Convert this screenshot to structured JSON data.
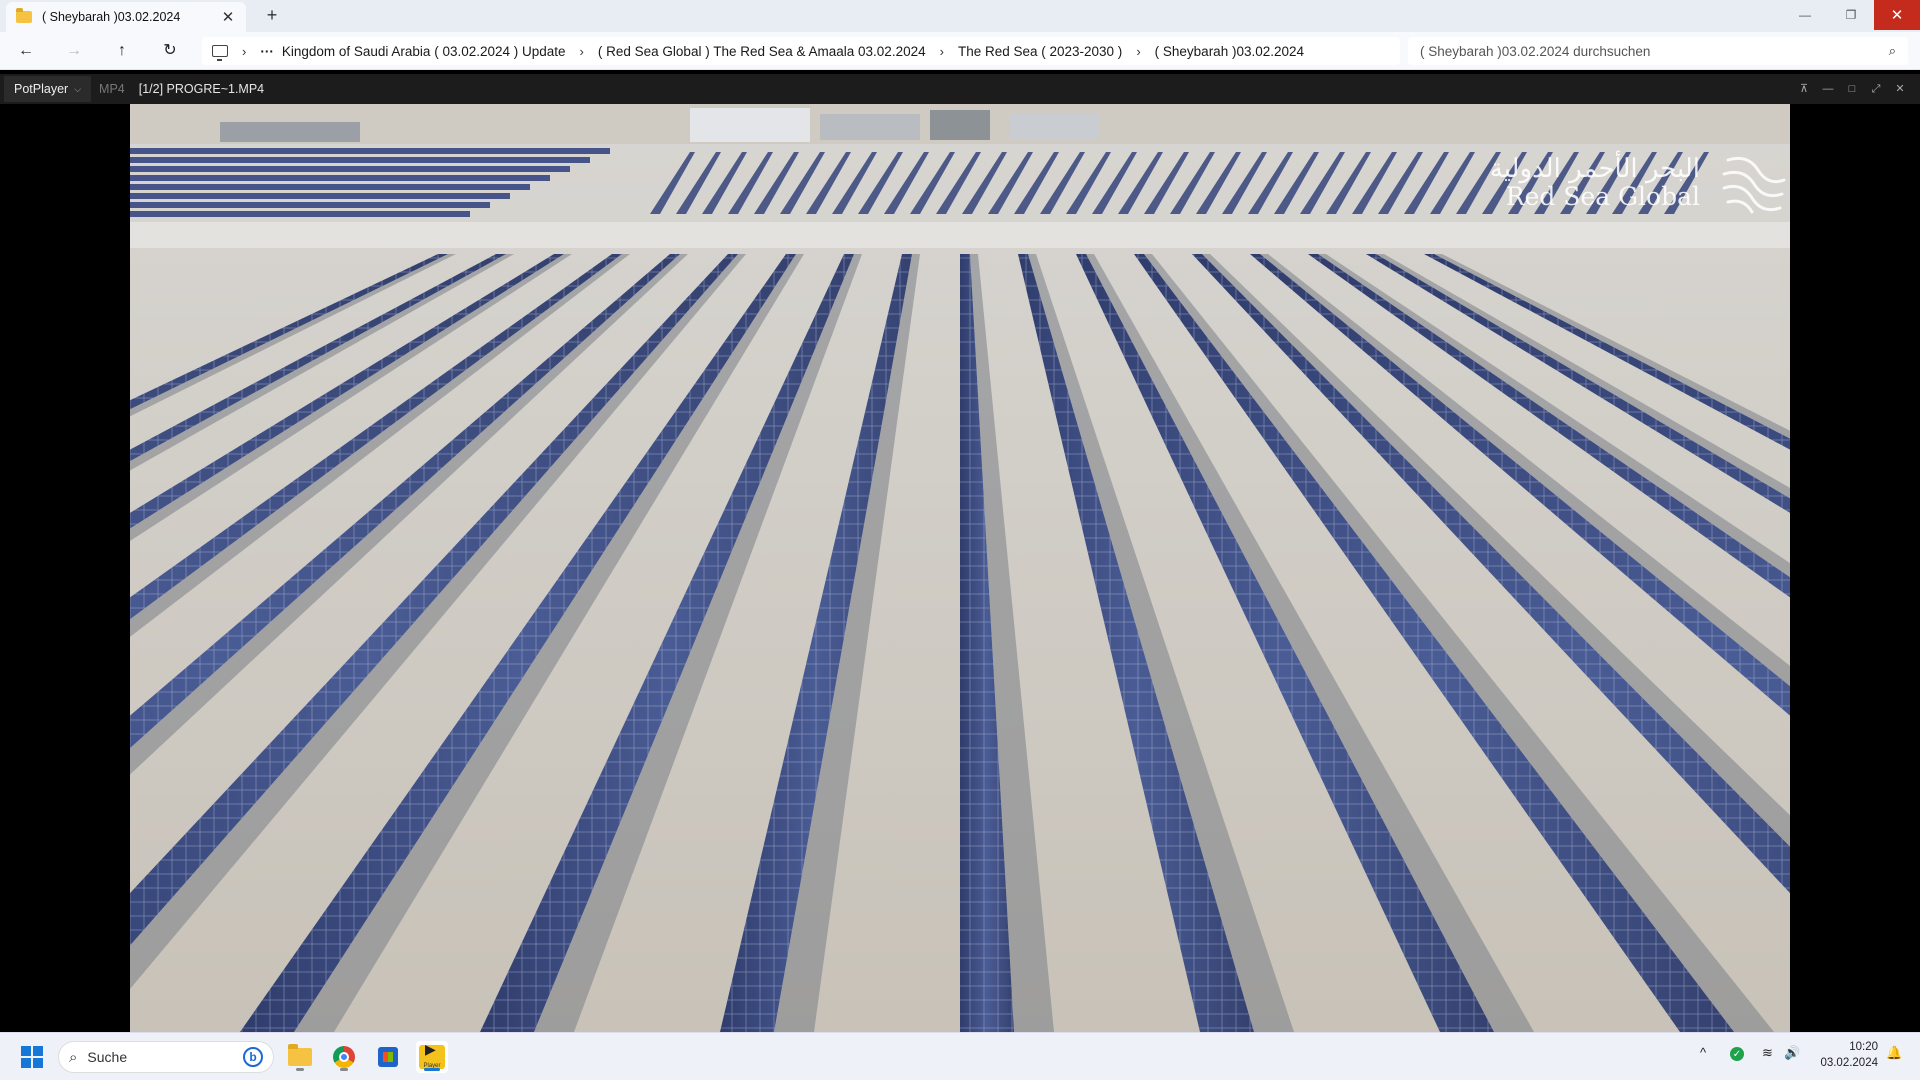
{
  "explorer": {
    "tab_title": "( Sheybarah )03.02.2024",
    "tab_close": "✕",
    "new_tab": "+",
    "window_controls": {
      "minimize": "—",
      "restore": "❐",
      "close": "✕"
    },
    "nav": {
      "back": "←",
      "forward": "→",
      "up": "↑",
      "refresh": "↻"
    },
    "breadcrumb_overflow": "···",
    "breadcrumbs": [
      "Kingdom of Saudi Arabia ( 03.02.2024 ) Update",
      "( Red Sea Global ) The Red Sea & Amaala 03.02.2024",
      "The Red Sea ( 2023-2030 )",
      "( Sheybarah )03.02.2024"
    ],
    "breadcrumb_separator": "›",
    "search_placeholder": "( Sheybarah )03.02.2024 durchsuchen",
    "search_icon": "⌕"
  },
  "player": {
    "brand": "PotPlayer",
    "brand_chevron": "⌵",
    "format": "MP4",
    "file": "[1/2] PROGRE~1.MP4",
    "controls": {
      "pin": "⊼",
      "minimize": "—",
      "maximize": "□",
      "fullscreen": "⤢",
      "close": "✕"
    },
    "watermark": {
      "arabic": "البحر الأحمر الدولية",
      "english": "Red Sea Global"
    }
  },
  "taskbar": {
    "search_label": "Suche",
    "bing_glyph": "b",
    "pot_label": "Player",
    "tray": {
      "chevron": "^",
      "wifi": "≋",
      "volume": "🔊",
      "bell": "🔔",
      "shield": "✓"
    },
    "time": "10:20",
    "date": "03.02.2024"
  },
  "colors": {
    "accent": "#1677d6",
    "close_red": "#c42b1c",
    "panel_blue": "#3e4e80",
    "sand": "#cfcbc4"
  }
}
